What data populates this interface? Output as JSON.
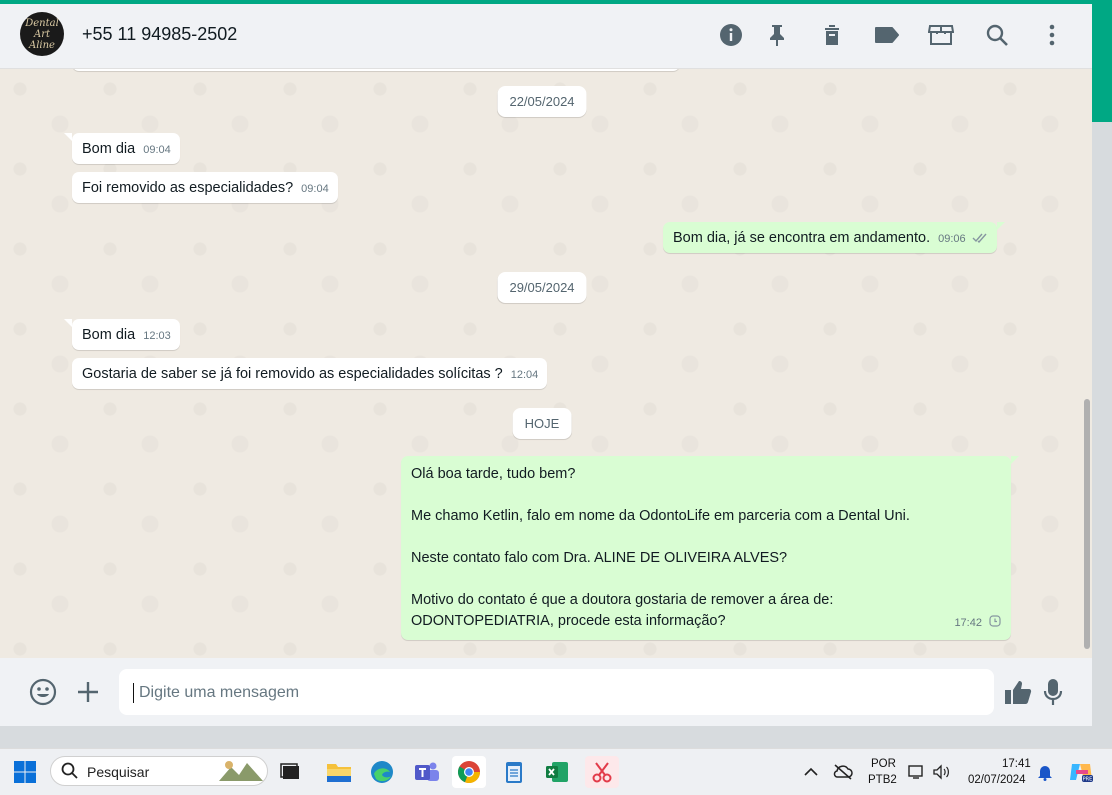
{
  "header": {
    "contact": "+55 11 94985-2502",
    "avatar_text": "Dental Art Aline",
    "icons": [
      "info-icon",
      "pin-icon",
      "delete-icon",
      "label-icon",
      "store-icon",
      "search-icon",
      "menu-icon"
    ]
  },
  "chat": {
    "dates": [
      "22/05/2024",
      "29/05/2024",
      "HOJE"
    ],
    "messages": [
      {
        "dir": "in",
        "text": "Bom dia",
        "time": "09:04"
      },
      {
        "dir": "in",
        "text": "Foi removido as especialidades?",
        "time": "09:04"
      },
      {
        "dir": "out",
        "text": "Bom dia, já se encontra em andamento.",
        "time": "09:06",
        "status": "read"
      },
      {
        "dir": "in",
        "text": "Bom dia",
        "time": "12:03"
      },
      {
        "dir": "in",
        "text": "Gostaria de saber se já foi removido as especialidades solícitas ?",
        "time": "12:04"
      },
      {
        "dir": "out",
        "lines": [
          "Olá boa tarde, tudo bem?",
          "Me chamo Ketlin, falo em nome da OdontoLife em parceria com a Dental Uni.",
          "Neste contato falo com Dra. ALINE DE OLIVEIRA ALVES?",
          "Motivo do contato é que a doutora gostaria de remover a área de: ODONTOPEDIATRIA, procede esta informação?"
        ],
        "time": "17:42",
        "status": "pending"
      }
    ]
  },
  "composer": {
    "placeholder": "Digite uma mensagem"
  },
  "taskbar": {
    "search_label": "Pesquisar",
    "lang_top": "POR",
    "lang_bottom": "PTB2",
    "time": "17:41",
    "date": "02/07/2024"
  },
  "colors": {
    "accent": "#00a884",
    "outgoing": "#d9fdd3",
    "incoming": "#ffffff"
  }
}
